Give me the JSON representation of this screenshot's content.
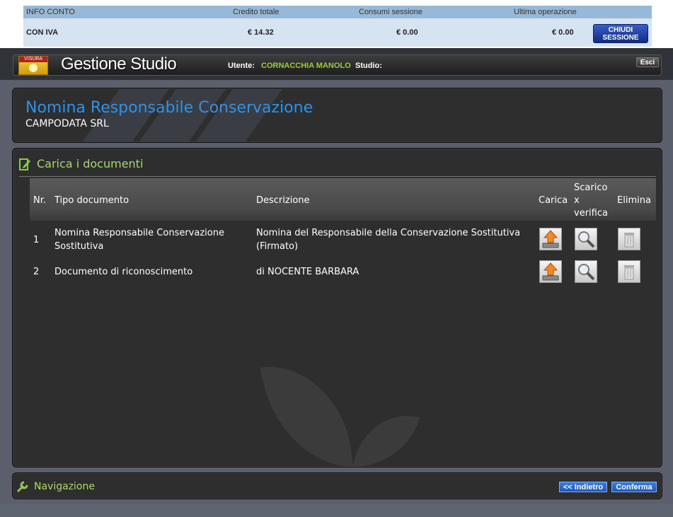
{
  "info_conto": {
    "header": {
      "label": "INFO CONTO",
      "credito": "Credito totale",
      "consumi": "Consumi sessione",
      "ultima": "Ultima operazione"
    },
    "row": {
      "label": "CON IVA",
      "credito": "€  14.32",
      "consumi": "€ 0.00",
      "ultima": "€ 0.00"
    },
    "close_button": {
      "line1": "CHIUDI",
      "line2": "SESSIONE"
    }
  },
  "appbar": {
    "logo_text": "VISURA",
    "brand": "Gestione Studio",
    "utente_label": "Utente:",
    "utente_value": "CORNACCHIA MANOLO",
    "studio_label": "Studio:",
    "esci_label": "Esci"
  },
  "page": {
    "title": "Nomina Responsabile Conservazione",
    "subtitle": "CAMPODATA SRL"
  },
  "documents": {
    "section_title": "Carica i documenti",
    "columns": {
      "nr": "Nr.",
      "tipo": "Tipo documento",
      "descrizione": "Descrizione",
      "carica": "Carica",
      "scarico_1": "Scarico",
      "scarico_2": "x",
      "scarico_3": "verifica",
      "elimina": "Elimina"
    },
    "rows": [
      {
        "nr": "1",
        "tipo_1": "Nomina Responsabile Conservazione",
        "tipo_2": "Sostitutiva",
        "desc_1": "Nomina del Responsabile della Conservazione Sostitutiva",
        "desc_2": "(Firmato)"
      },
      {
        "nr": "2",
        "tipo_1": "Documento di riconoscimento",
        "tipo_2": "",
        "desc_1": "di NOCENTE BARBARA",
        "desc_2": ""
      }
    ]
  },
  "navigation": {
    "title": "Navigazione",
    "back_label": "<< Indietro",
    "confirm_label": "Conferma"
  },
  "colors": {
    "title_blue": "#2a94ec",
    "section_green": "#a8d86a",
    "user_green": "#9ccc3c",
    "button_blue": "#1d55c0"
  }
}
